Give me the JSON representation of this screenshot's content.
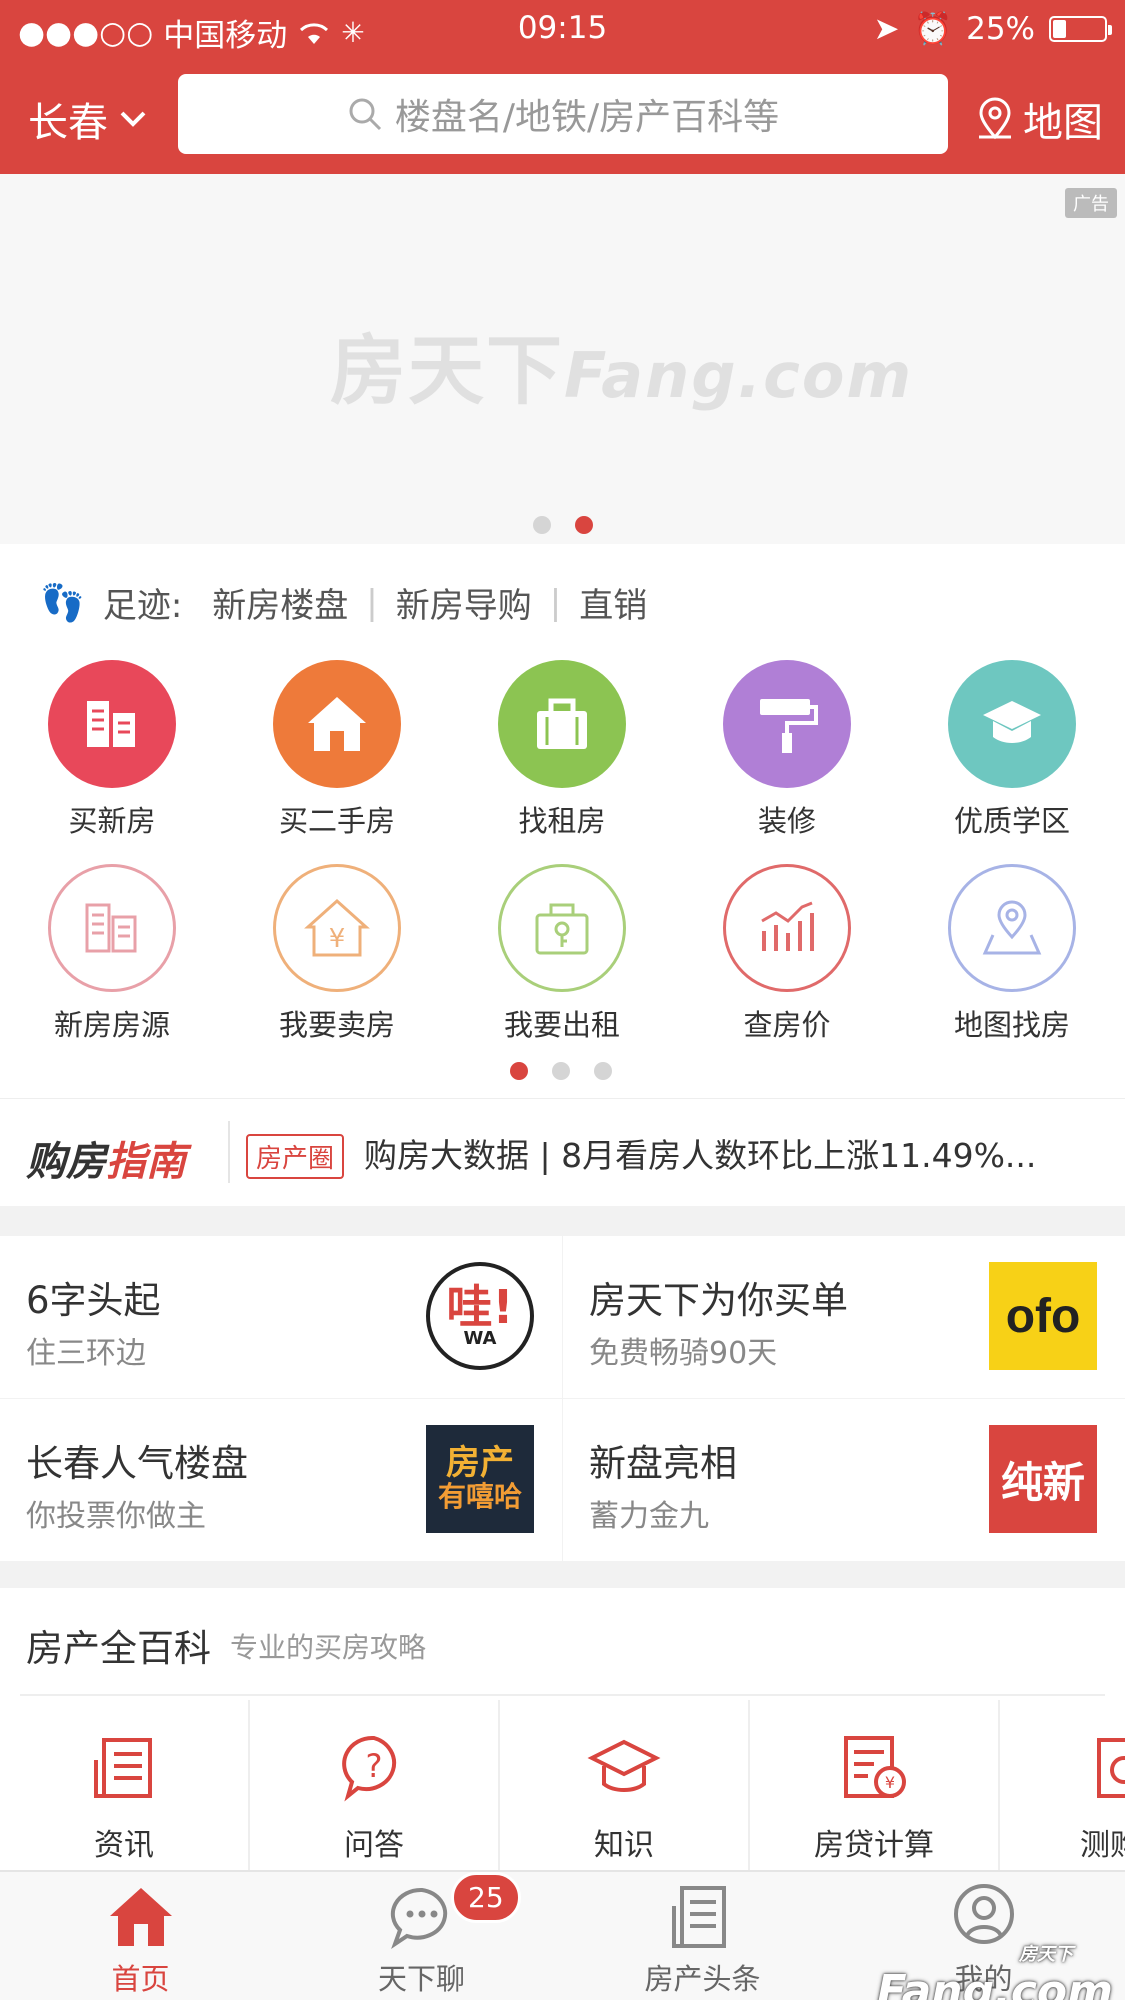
{
  "status": {
    "signal": "●●●○○",
    "carrier": "中国移动",
    "time": "09:15",
    "battery": "25%",
    "battery_level": 0.25
  },
  "header": {
    "city": "长春",
    "search_placeholder": "楼盘名/地铁/房产百科等",
    "map_label": "地图"
  },
  "banner": {
    "ad_tag": "广告",
    "logo_cn": "房天下",
    "logo_en": "Fang.com",
    "active_dot": 1
  },
  "footprint": {
    "label": "足迹:",
    "items": [
      "新房楼盘",
      "新房导购",
      "直销"
    ]
  },
  "grid": {
    "row1": [
      {
        "label": "买新房",
        "icon": "building-icon",
        "color": "#e8485a"
      },
      {
        "label": "买二手房",
        "icon": "house-icon",
        "color": "#ee7a3a"
      },
      {
        "label": "找租房",
        "icon": "bag-icon",
        "color": "#8cc452"
      },
      {
        "label": "装修",
        "icon": "paint-roller-icon",
        "color": "#b07fd6"
      },
      {
        "label": "优质学区",
        "icon": "graduation-cap-icon",
        "color": "#6ec7c0"
      }
    ],
    "row2": [
      {
        "label": "新房房源",
        "icon": "building-outline-icon",
        "color": "#e8a0a8"
      },
      {
        "label": "我要卖房",
        "icon": "house-yen-icon",
        "color": "#efb07a"
      },
      {
        "label": "我要出租",
        "icon": "bag-key-icon",
        "color": "#a9cf7a"
      },
      {
        "label": "查房价",
        "icon": "price-chart-icon",
        "color": "#e06a6a"
      },
      {
        "label": "地图找房",
        "icon": "map-pin-icon",
        "color": "#a7b3e6"
      }
    ],
    "active_page": 0
  },
  "guide": {
    "title_a": "购房",
    "title_b": "指南",
    "tag": "房产圈",
    "headline": "购房大数据 | 8月看房人数环比上涨11.49%..."
  },
  "promos": [
    {
      "title": "6字头起",
      "subtitle": "住三环边",
      "img_text": "哇!",
      "img_sub": "WA"
    },
    {
      "title": "房天下为你买单",
      "subtitle": "免费畅骑90天",
      "img_text": "ofo"
    },
    {
      "title": "长春人气楼盘",
      "subtitle": "你投票你做主",
      "img_text": "房产",
      "img_sub": "有嘻哈"
    },
    {
      "title": "新盘亮相",
      "subtitle": "蓄力金九",
      "img_text": "纯新"
    }
  ],
  "wiki": {
    "title": "房产全百科",
    "subtitle": "专业的买房攻略",
    "items": [
      {
        "label": "资讯",
        "icon": "news-icon"
      },
      {
        "label": "问答",
        "icon": "question-icon"
      },
      {
        "label": "知识",
        "icon": "graduation-cap-icon"
      },
      {
        "label": "房贷计算",
        "icon": "loan-calculator-icon"
      },
      {
        "label": "测购房",
        "icon": "test-icon"
      }
    ]
  },
  "tabbar": {
    "items": [
      {
        "label": "首页",
        "icon": "home-icon",
        "active": true
      },
      {
        "label": "天下聊",
        "icon": "chat-icon",
        "badge": "25"
      },
      {
        "label": "房产头条",
        "icon": "headline-icon"
      },
      {
        "label": "我的",
        "icon": "user-icon"
      }
    ]
  },
  "watermark": "Fang.com",
  "watermark_top": "房天下"
}
